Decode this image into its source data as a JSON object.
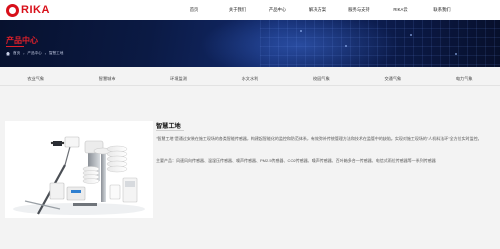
{
  "logo": {
    "text": "RIKA",
    "brand_color": "#d8101a"
  },
  "nav": {
    "items": [
      {
        "label": "首页"
      },
      {
        "label": "关于我们"
      },
      {
        "label": "产品中心"
      },
      {
        "label": "解决方案"
      },
      {
        "label": "服务与支持"
      },
      {
        "label": "RIKA云"
      },
      {
        "label": "联系我们"
      }
    ]
  },
  "banner": {
    "title": "产品中心",
    "breadcrumb": [
      "首页",
      "产品中心",
      "智慧工地"
    ],
    "accent_color": "#e0202a"
  },
  "subnav": {
    "items": [
      {
        "label": "农业气象"
      },
      {
        "label": "智慧城市"
      },
      {
        "label": "环境监测"
      },
      {
        "label": "水文水利"
      },
      {
        "label": "校园气象"
      },
      {
        "label": "交通气象"
      },
      {
        "label": "电力气象"
      }
    ]
  },
  "product": {
    "title": "智慧工地",
    "description": "\"智慧工地\"是通过安装在施工现场的各类智能传感器，构建起智能化的监控和防范体系，有效弥补传统管理方法和技术在监管中的缺陷。实现对施工现场的\"人机料法环\"全方位实时监控。",
    "products_line": "主要产品：风速风向传感器、温湿压传感器、噪声传感器、PM2.5传感器、CO2传感器、噪声传感器、百叶箱多合一传感器、电信式雨位传感器等一系列传感器"
  }
}
